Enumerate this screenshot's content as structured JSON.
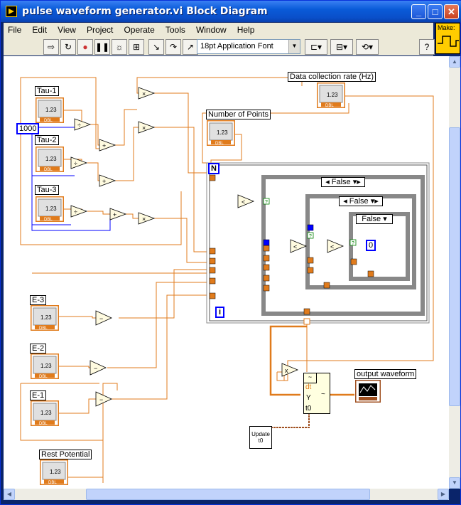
{
  "window": {
    "title": "pulse waveform generator.vi Block Diagram",
    "min_btn": "_",
    "max_btn": "□",
    "close_btn": "✕"
  },
  "menu": [
    "File",
    "Edit",
    "View",
    "Project",
    "Operate",
    "Tools",
    "Window",
    "Help"
  ],
  "toolbar": {
    "icons": [
      "run-arrow-icon",
      "run-continuous-icon",
      "abort-icon",
      "pause-icon",
      "highlight-execution-icon",
      "retain-wire-values-icon",
      "step-into-icon",
      "step-over-icon",
      "step-out-icon"
    ],
    "font": "18pt Application Font",
    "help_icon": "?"
  },
  "make_label": "Make:",
  "diagram": {
    "controls": {
      "tau1": "Tau-1",
      "tau2": "Tau-2",
      "tau3": "Tau-3",
      "data_rate": "Data collection rate (Hz)",
      "num_points": "Number of Points",
      "e3": "E-3",
      "e2": "E-2",
      "e1": "E-1",
      "rest": "Rest Potential",
      "output": "output waveform"
    },
    "terminal_text": "1.23",
    "terminal_type": "DBL",
    "constant_1000": "1000",
    "constant_0": "0",
    "loop_n": "N",
    "loop_i": "i",
    "case_false": "False",
    "build_wf": {
      "dt": "dt",
      "y": "Y",
      "t0": "t0"
    },
    "update_t0": "Update t0"
  },
  "colors": {
    "orange_wire": "#e07b1c",
    "blue_wire": "#0000ff",
    "green_wire": "#008000",
    "brown_wire": "#a05020"
  }
}
